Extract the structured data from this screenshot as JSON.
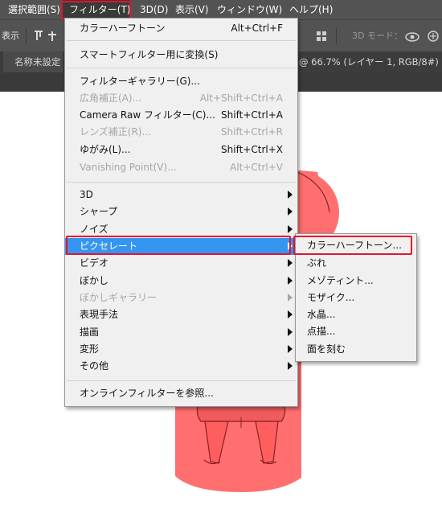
{
  "menubar": {
    "items": [
      {
        "label": "選択範囲(S)"
      },
      {
        "label": "フィルター(T)"
      },
      {
        "label": "3D(D)"
      },
      {
        "label": "表示(V)"
      },
      {
        "label": "ウィンドウ(W)"
      },
      {
        "label": "ヘルプ(H)"
      }
    ],
    "active_index": 1
  },
  "options_bar": {
    "left_text": "表示",
    "mode_label": "3D モード："
  },
  "tabs": {
    "left_label": "名称未設定",
    "doc_info": "@ 66.7% (レイヤー 1, RGB/8#) *"
  },
  "filter_menu": {
    "items": [
      {
        "label": "カラーハーフトーン",
        "shortcut": "Alt+Ctrl+F"
      },
      {
        "label": "スマートフィルター用に変換(S)"
      },
      {
        "label": "フィルターギャラリー(G)..."
      },
      {
        "label": "広角補正(A)...",
        "shortcut": "Alt+Shift+Ctrl+A",
        "disabled": true
      },
      {
        "label": "Camera Raw フィルター(C)...",
        "shortcut": "Shift+Ctrl+A"
      },
      {
        "label": "レンズ補正(R)...",
        "shortcut": "Shift+Ctrl+R",
        "disabled": true
      },
      {
        "label": "ゆがみ(L)...",
        "shortcut": "Shift+Ctrl+X"
      },
      {
        "label": "Vanishing Point(V)...",
        "shortcut": "Alt+Ctrl+V",
        "disabled": true
      },
      {
        "label": "3D"
      },
      {
        "label": "シャープ"
      },
      {
        "label": "ノイズ"
      },
      {
        "label": "ピクセレート",
        "selected": true
      },
      {
        "label": "ビデオ"
      },
      {
        "label": "ぼかし"
      },
      {
        "label": "ぼかしギャラリー",
        "disabled": true
      },
      {
        "label": "表現手法"
      },
      {
        "label": "描画"
      },
      {
        "label": "変形"
      },
      {
        "label": "その他"
      },
      {
        "label": "オンラインフィルターを参照..."
      }
    ]
  },
  "pixelate_submenu": {
    "items": [
      {
        "label": "カラーハーフトーン..."
      },
      {
        "label": "ぶれ"
      },
      {
        "label": "メゾティント..."
      },
      {
        "label": "モザイク..."
      },
      {
        "label": "水晶..."
      },
      {
        "label": "点描..."
      },
      {
        "label": "面を刻む"
      }
    ]
  },
  "colors": {
    "menubar_bg": "#535353",
    "menu_bg": "#f0f0f0",
    "selection_blue": "#3496f0",
    "highlight_red": "#e8112d",
    "figure_fill": "#ff6f6f",
    "figure_dark": "#8a1f24"
  }
}
